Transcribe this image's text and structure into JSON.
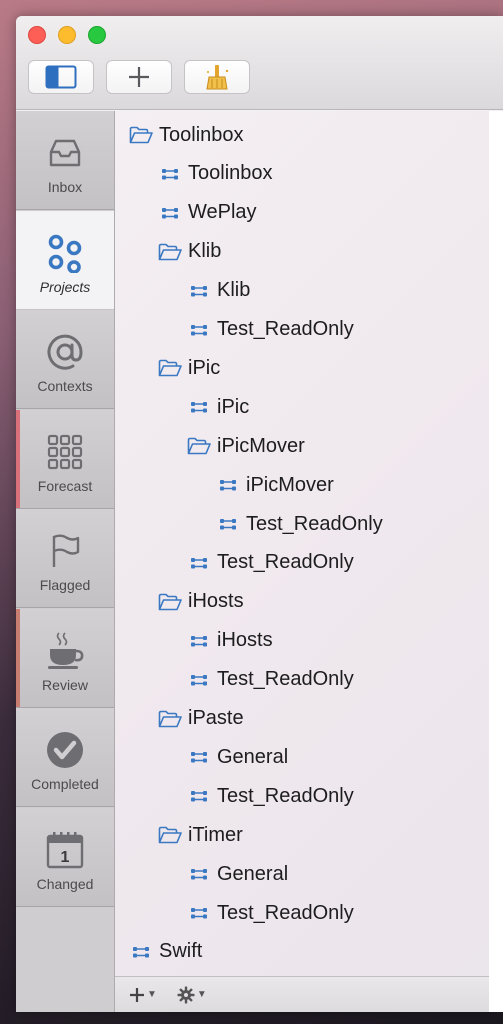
{
  "perspectives": [
    {
      "label": "Inbox",
      "icon": "inbox-tray-icon",
      "selected": false
    },
    {
      "label": "Projects",
      "icon": "projects-dots-icon",
      "selected": true
    },
    {
      "label": "Contexts",
      "icon": "at-sign-icon",
      "selected": false
    },
    {
      "label": "Forecast",
      "icon": "forecast-grid-icon",
      "selected": false,
      "stripe": "#d9707a"
    },
    {
      "label": "Flagged",
      "icon": "flag-icon",
      "selected": false
    },
    {
      "label": "Review",
      "icon": "coffee-cup-icon",
      "selected": false,
      "stripe": "#c77d70"
    },
    {
      "label": "Completed",
      "icon": "checkmark-circle-icon",
      "selected": false
    },
    {
      "label": "Changed",
      "icon": "calendar-icon",
      "selected": false
    }
  ],
  "calendar_day": "1",
  "outline": [
    {
      "label": "Toolinbox",
      "type": "folder",
      "level": 0
    },
    {
      "label": "Toolinbox",
      "type": "project",
      "level": 1
    },
    {
      "label": "WePlay",
      "type": "project",
      "level": 1
    },
    {
      "label": "Klib",
      "type": "folder",
      "level": 1
    },
    {
      "label": "Klib",
      "type": "project",
      "level": 2
    },
    {
      "label": "Test_ReadOnly",
      "type": "project",
      "level": 2
    },
    {
      "label": "iPic",
      "type": "folder",
      "level": 1
    },
    {
      "label": "iPic",
      "type": "project",
      "level": 2
    },
    {
      "label": "iPicMover",
      "type": "folder",
      "level": 2
    },
    {
      "label": "iPicMover",
      "type": "project",
      "level": 3
    },
    {
      "label": "Test_ReadOnly",
      "type": "project",
      "level": 3
    },
    {
      "label": "Test_ReadOnly",
      "type": "project",
      "level": 2
    },
    {
      "label": "iHosts",
      "type": "folder",
      "level": 1
    },
    {
      "label": "iHosts",
      "type": "project",
      "level": 2
    },
    {
      "label": "Test_ReadOnly",
      "type": "project",
      "level": 2
    },
    {
      "label": "iPaste",
      "type": "folder",
      "level": 1
    },
    {
      "label": "General",
      "type": "project",
      "level": 2
    },
    {
      "label": "Test_ReadOnly",
      "type": "project",
      "level": 2
    },
    {
      "label": "iTimer",
      "type": "folder",
      "level": 1
    },
    {
      "label": "General",
      "type": "project",
      "level": 2
    },
    {
      "label": "Test_ReadOnly",
      "type": "project",
      "level": 2
    },
    {
      "label": "Swift",
      "type": "project",
      "level": 0
    }
  ],
  "colors": {
    "accent_blue": "#3a78c2",
    "icon_gray": "#6e6d72"
  },
  "toolbar": {
    "sidebar_icon": "sidebar-toggle-icon",
    "add_icon": "plus-icon",
    "clean_up_icon": "broom-icon"
  },
  "footer": {
    "add_icon": "plus-icon",
    "settings_icon": "gear-icon"
  }
}
